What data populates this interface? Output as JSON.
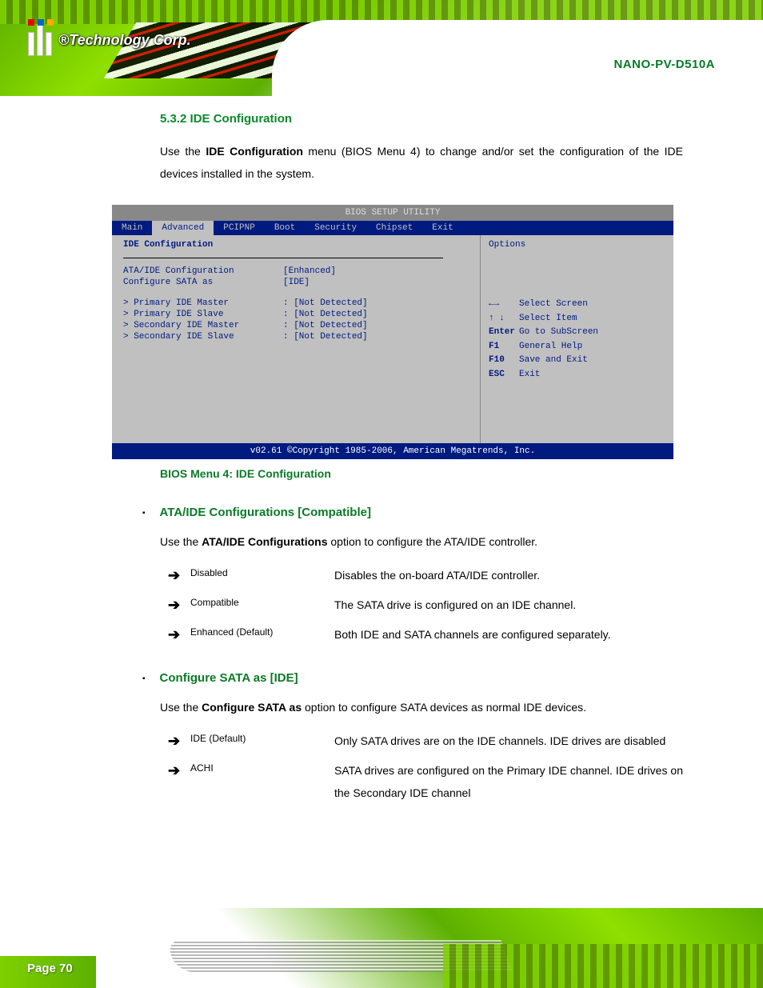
{
  "header": {
    "logo_text": "®Technology Corp.",
    "model": "NANO-PV-D510A"
  },
  "section_title": "5.3.2 IDE Configuration",
  "intro": {
    "before": "Use the ",
    "bold": "IDE Configuration",
    "after_1": " menu (BIOS Menu 4) to change and/or set the configuration of the IDE devices installed in the system."
  },
  "bios": {
    "title_bar": "BIOS SETUP UTILITY",
    "tabs": [
      "Main",
      "Advanced",
      "PCIPNP",
      "Boot",
      "Security",
      "Chipset",
      "Exit"
    ],
    "active_tab_index": 1,
    "heading": "IDE Configuration",
    "options": [
      {
        "key": "ATA/IDE Configuration",
        "value": "[Enhanced]"
      },
      {
        "key": "Configure SATA as",
        "value": "[IDE]"
      }
    ],
    "drives": [
      {
        "key": "Primary IDE Master",
        "value": ": [Not Detected]"
      },
      {
        "key": "Primary IDE Slave",
        "value": ": [Not Detected]"
      },
      {
        "key": "Secondary IDE Master",
        "value": ": [Not Detected]"
      },
      {
        "key": "Secondary IDE Slave",
        "value": ": [Not Detected]"
      }
    ],
    "help_text": "Options",
    "keys": [
      {
        "sym": "←→",
        "label": "Select Screen"
      },
      {
        "sym": "↑ ↓",
        "label": "Select Item"
      },
      {
        "sym": "Enter",
        "label": "Go to SubScreen"
      },
      {
        "sym": "F1",
        "label": "General Help"
      },
      {
        "sym": "F10",
        "label": "Save and Exit"
      },
      {
        "sym": "ESC",
        "label": "Exit"
      }
    ],
    "footer": "v02.61 ©Copyright 1985-2006, American Megatrends, Inc.",
    "caption": "BIOS Menu 4: IDE Configuration"
  },
  "items": [
    {
      "title": "ATA/IDE Configurations [Compatible]",
      "desc_before": "Use the ",
      "desc_bold": "ATA/IDE Configurations",
      "desc_after": " option to configure the ATA/IDE controller.",
      "options": [
        {
          "name": "Disabled",
          "desc": "Disables the on-board ATA/IDE controller."
        },
        {
          "name": "Compatible",
          "desc": "The SATA drive is configured on an IDE channel."
        },
        {
          "name": "Enhanced  (Default)",
          "desc": "Both IDE and SATA channels are configured separately."
        }
      ]
    },
    {
      "title": "Configure SATA as [IDE]",
      "desc_before": "Use the ",
      "desc_bold": "Configure SATA as",
      "desc_after": " option to configure SATA devices as normal IDE devices.",
      "options": [
        {
          "name": "IDE  (Default)",
          "desc": "Only SATA drives are on the IDE channels. IDE drives are disabled"
        },
        {
          "name": "ACHI",
          "desc": "SATA drives are configured on the Primary IDE channel. IDE drives on the Secondary IDE channel"
        }
      ]
    }
  ],
  "page_number": "Page 70"
}
